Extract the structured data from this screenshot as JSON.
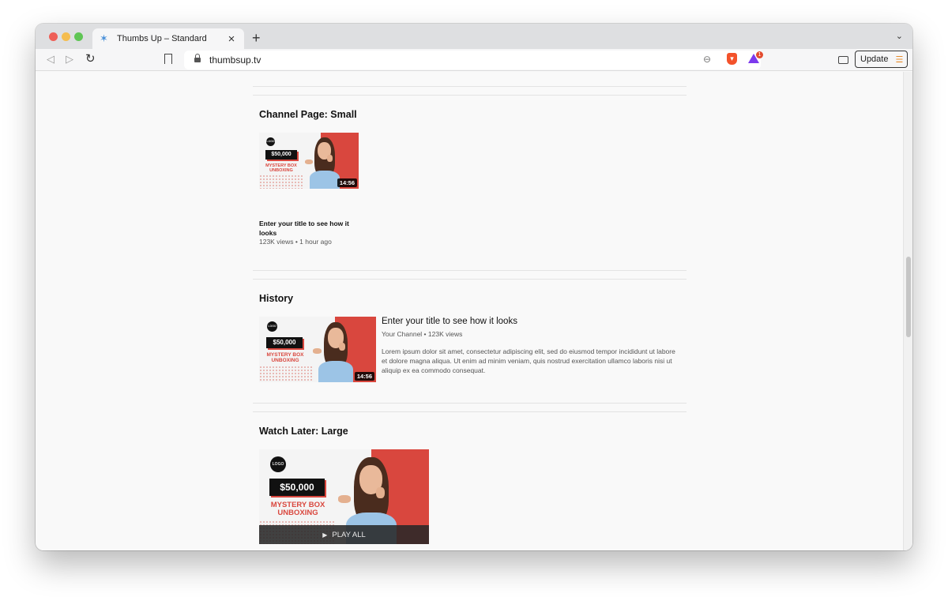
{
  "browser": {
    "tab_title": "Thumbs Up – Standard",
    "url": "thumbsup.tv",
    "update_label": "Update",
    "rewards_badge": "1"
  },
  "sections": {
    "channel_small": {
      "title": "Channel Page: Small"
    },
    "history": {
      "title": "History"
    },
    "watch_later": {
      "title": "Watch Later: Large"
    }
  },
  "thumbnail": {
    "logo": "LOGO",
    "price": "$50,000",
    "headline_line1": "MYSTERY BOX",
    "headline_line2": "UNBOXING",
    "duration": "14:56"
  },
  "video": {
    "title": "Enter your title to see how it looks",
    "meta_channel_page": "123K views • 1 hour ago",
    "meta_history": "Your Channel • 123K views",
    "description": "Lorem ipsum dolor sit amet, consectetur adipiscing elit, sed do eiusmod tempor incididunt ut labore et dolore magna aliqua. Ut enim ad minim veniam, quis nostrud exercitation ullamco laboris nisi ut aliquip ex ea commodo consequat."
  },
  "watch_later": {
    "play_all_label": "PLAY ALL"
  },
  "colors": {
    "accent_red": "#d9473e",
    "brave_orange": "#f3522b",
    "update_menu": "#e88c2b"
  }
}
